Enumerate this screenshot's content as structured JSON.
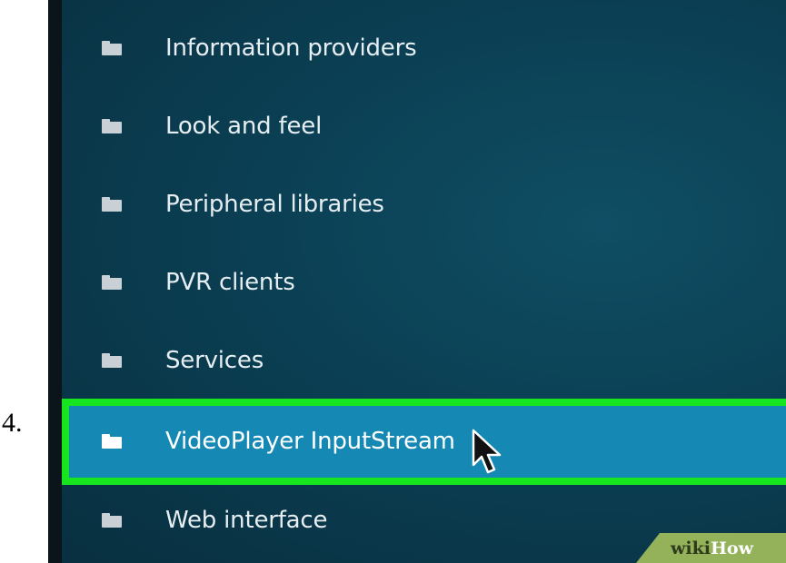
{
  "step": {
    "number": "4."
  },
  "menu": {
    "items": [
      {
        "label": "Information providers",
        "icon": "folder-icon",
        "selected": false
      },
      {
        "label": "Look and feel",
        "icon": "folder-icon",
        "selected": false
      },
      {
        "label": "Peripheral libraries",
        "icon": "folder-icon",
        "selected": false
      },
      {
        "label": "PVR clients",
        "icon": "folder-icon",
        "selected": false
      },
      {
        "label": "Services",
        "icon": "folder-icon",
        "selected": false
      },
      {
        "label": "VideoPlayer InputStream",
        "icon": "folder-icon",
        "selected": true
      },
      {
        "label": "Web interface",
        "icon": "folder-icon",
        "selected": false
      }
    ]
  },
  "annotation": {
    "highlight_color": "#17e51f"
  },
  "colors": {
    "background": "#0b3f53",
    "selected_row": "#1589b3",
    "text": "#e6eef2"
  },
  "watermark": {
    "part1": "wiki",
    "part2": "How"
  }
}
